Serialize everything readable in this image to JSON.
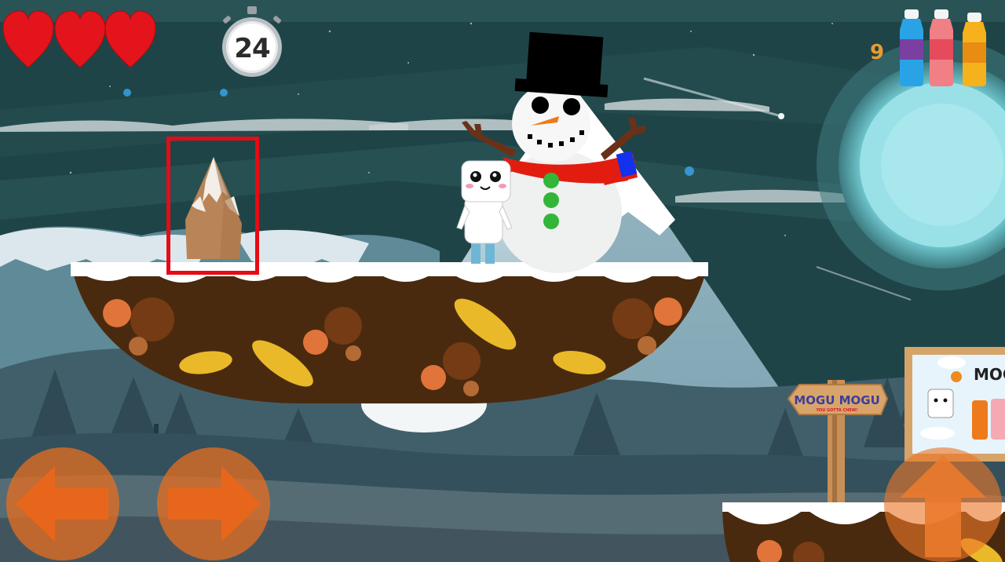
{
  "hud": {
    "lives": 3,
    "timer": "24",
    "score": "9"
  },
  "sign": {
    "title": "MOGU MOGU",
    "subtitle": "YOU GOTTA CHEW!"
  },
  "billboard": {
    "text": "MOG"
  },
  "colors": {
    "sky": "#1e4548",
    "heart": "#e3141b",
    "button": "#e86e20",
    "platform": "#4a2a0f",
    "snow": "#ffffff",
    "highlight": "#e60b14"
  },
  "icons": [
    "heart-icon",
    "stopwatch-icon",
    "bottle-icon",
    "left-arrow-icon",
    "right-arrow-icon",
    "up-arrow-icon"
  ]
}
